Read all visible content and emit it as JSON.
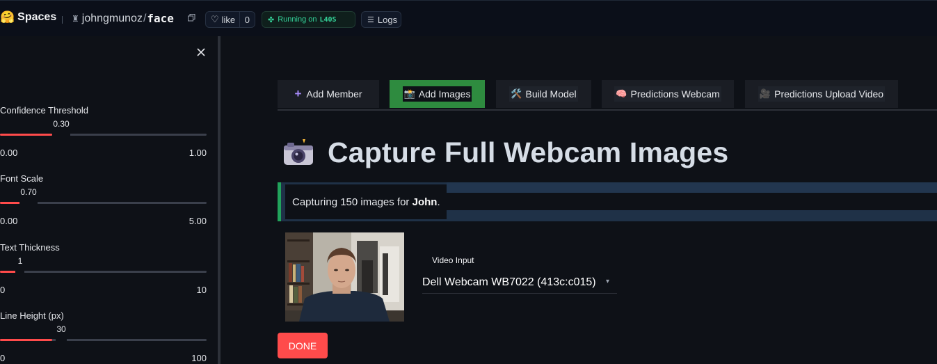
{
  "topbar": {
    "brand_emoji": "🤗",
    "brand_label": "Spaces",
    "repo_owner": "johngmunoz",
    "repo_slash": "/",
    "repo_name": "face",
    "like_label": "like",
    "like_count": "0",
    "status_prefix": "Running on",
    "status_hardware": "L40S",
    "logs_label": "Logs",
    "icons": [
      "copy-icon",
      "heart-icon",
      "status-dot-icon",
      "logs-icon",
      "avatar-icon"
    ]
  },
  "sidebar": {
    "close_icon": "close-icon",
    "sliders": [
      {
        "label": "Confidence Threshold",
        "value": "0.30",
        "min": "0.00",
        "max": "1.00",
        "fraction": 0.3
      },
      {
        "label": "Font Scale",
        "value": "0.70",
        "min": "0.00",
        "max": "5.00",
        "fraction": 0.14
      },
      {
        "label": "Text Thickness",
        "value": "1",
        "min": "0",
        "max": "10",
        "fraction": 0.1
      },
      {
        "label": "Line Height (px)",
        "value": "30",
        "min": "0",
        "max": "100",
        "fraction": 0.3
      }
    ],
    "accent_color": "#ff4b4b"
  },
  "tabs": [
    {
      "label": "Add Member",
      "icon": "plus-icon",
      "glyph": ""
    },
    {
      "label": "Add Images",
      "icon": "camera-icon",
      "glyph": "📸",
      "active": true
    },
    {
      "label": "Build Model",
      "icon": "tools-icon",
      "glyph": "🛠️"
    },
    {
      "label": "Predictions Webcam",
      "icon": "brain-icon",
      "glyph": "🧠"
    },
    {
      "label": "Predictions Upload Video",
      "icon": "movie-camera-icon",
      "glyph": "🎥"
    }
  ],
  "main": {
    "heading": "Capture Full Webcam Images",
    "heading_icon": "camera-flash-icon",
    "info_prefix": "Capturing 150 images for ",
    "info_name": "John",
    "info_suffix": ".",
    "video_input_label": "Video Input",
    "video_input_value": "Dell Webcam WB7022 (413c:c015)",
    "done_label": "DONE"
  },
  "colors": {
    "background": "#0e1117",
    "active_tab": "#2e8b3f",
    "info_bar": "#21a35b",
    "button": "#ff4b4b",
    "status": "#34d399"
  }
}
